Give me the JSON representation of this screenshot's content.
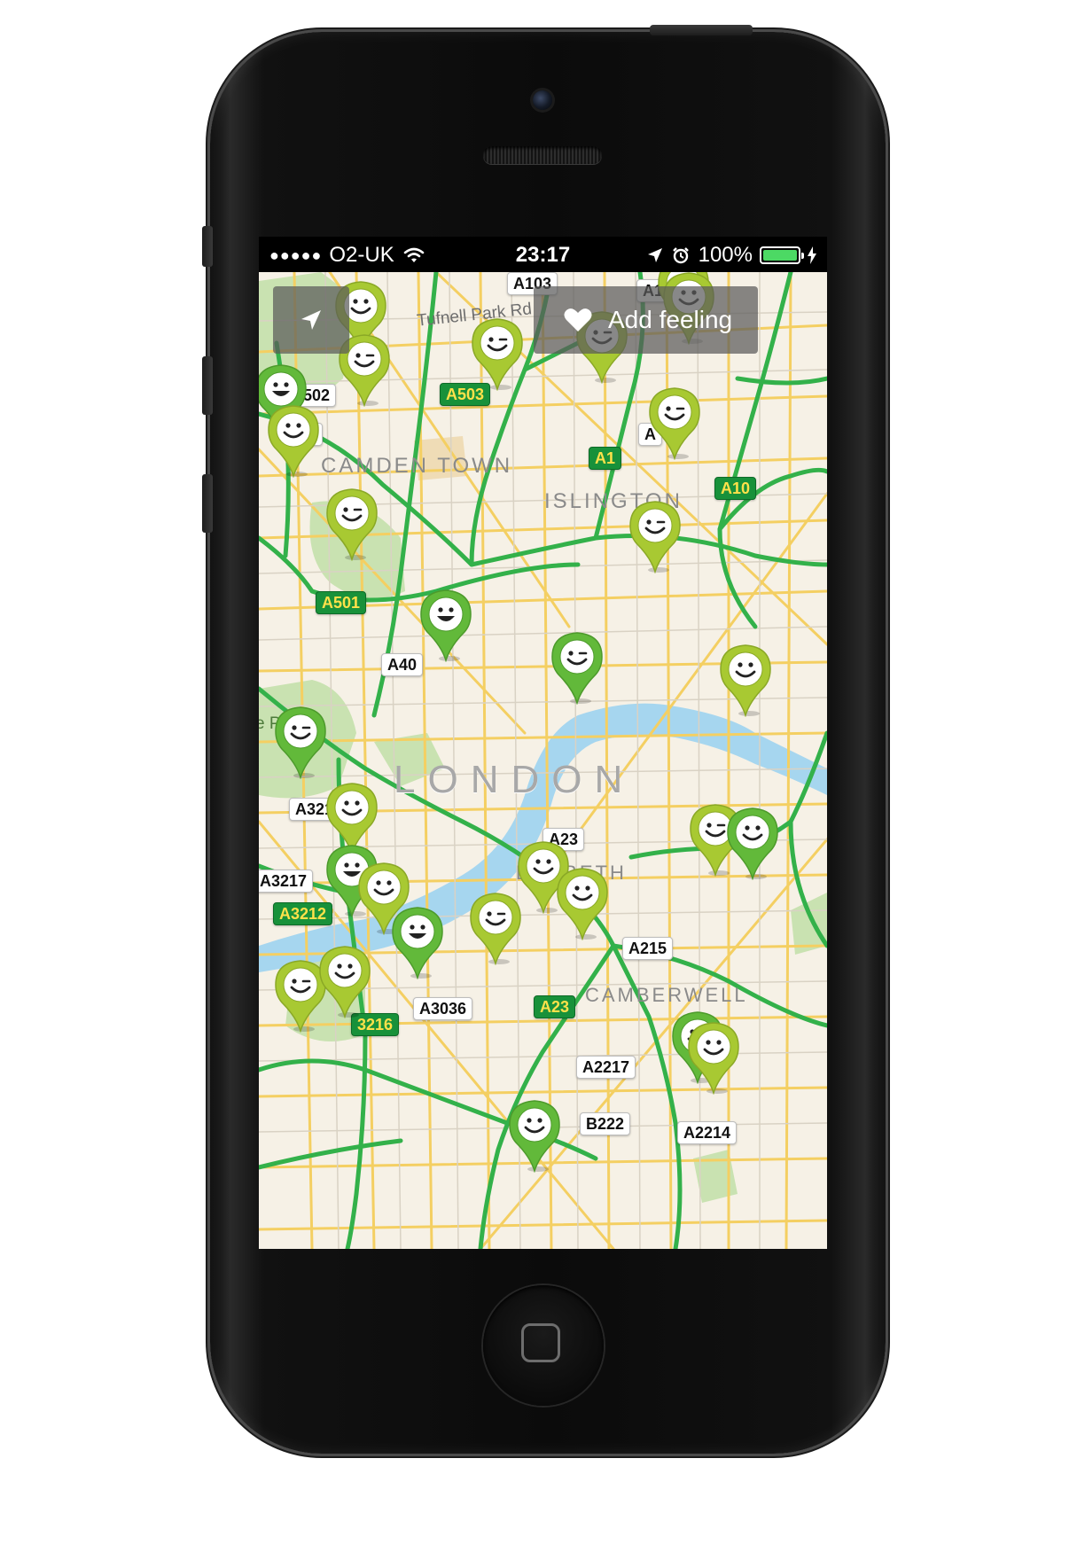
{
  "statusbar": {
    "signal_dots": "●●●●●",
    "carrier": "O2-UK",
    "time": "23:17",
    "battery_percent": "100%",
    "battery_level": 1.0,
    "icons": [
      "signal-dots-icon",
      "wifi-icon",
      "location-arrow-icon",
      "alarm-icon",
      "battery-icon",
      "charging-bolt-icon"
    ]
  },
  "toolbar": {
    "locate_icon": "location-arrow-icon",
    "add_feeling_icon": "heart-icon",
    "add_feeling_label": "Add feeling"
  },
  "map": {
    "city_label": "LONDON",
    "area_labels": {
      "camden": "CAMDEN TOWN",
      "islington": "ISLINGTON",
      "lambeth": "LAMBETH",
      "camberwell": "CAMBERWELL"
    },
    "street_labels": {
      "tufnell": "Tufnell Park Rd",
      "park": "e Park"
    },
    "road_labels": {
      "a103": "A103",
      "a10_top": "A10",
      "a502": "A502",
      "a503": "A503",
      "a09": "09",
      "a_partial": "A",
      "a1": "A1",
      "a10": "A10",
      "a501": "A501",
      "a40": "A40",
      "a3216": "A3216",
      "a23_mid": "A23",
      "a3217": "A3217",
      "a3212": "A3212",
      "a215": "A215",
      "a3036": "A3036",
      "a23_green": "A23",
      "a3216_green": "3216",
      "a2217": "A2217",
      "b222": "B222",
      "a2214": "A2214"
    },
    "pin_icon": "smiley-pin-icon",
    "pin_colors": {
      "yellow_green": "#a8c932",
      "green": "#62b93a"
    },
    "road_color": "#33b14a",
    "minor_road_color": "#f4cf62",
    "water_color": "#a6d6ef",
    "park_color": "#c9e2b1"
  }
}
